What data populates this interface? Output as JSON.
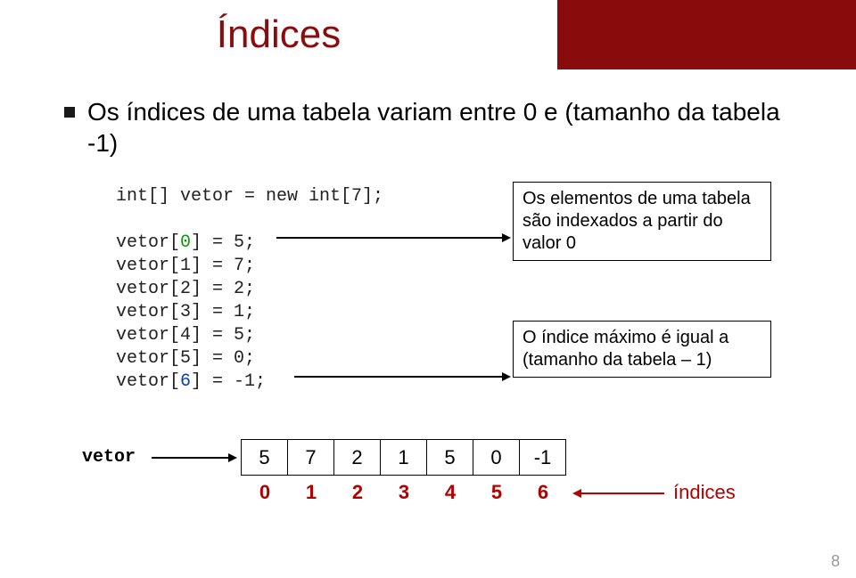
{
  "title": "Índices",
  "bullet": "Os índices de uma tabela variam entre 0 e (tamanho da tabela -1)",
  "code": {
    "decl": "int[] vetor = new int[7];",
    "l0a": "vetor[",
    "l0i": "0",
    "l0b": "] = 5;",
    "l1": "vetor[1] = 7;",
    "l2": "vetor[2] = 2;",
    "l3": "vetor[3] = 1;",
    "l4": "vetor[4] = 5;",
    "l5": "vetor[5] = 0;",
    "l6a": "vetor[",
    "l6i": "6",
    "l6b": "] = -1;"
  },
  "callout_top": "Os elementos de uma tabela são indexados a partir do valor 0",
  "callout_bot": "O índice máximo é igual a (tamanho da tabela – 1)",
  "vetor_label": "vetor",
  "array": {
    "c0": "5",
    "c1": "7",
    "c2": "2",
    "c3": "1",
    "c4": "5",
    "c5": "0",
    "c6": "-1"
  },
  "idx": {
    "i0": "0",
    "i1": "1",
    "i2": "2",
    "i3": "3",
    "i4": "4",
    "i5": "5",
    "i6": "6"
  },
  "indices_label": "índices",
  "pagenum": "8"
}
